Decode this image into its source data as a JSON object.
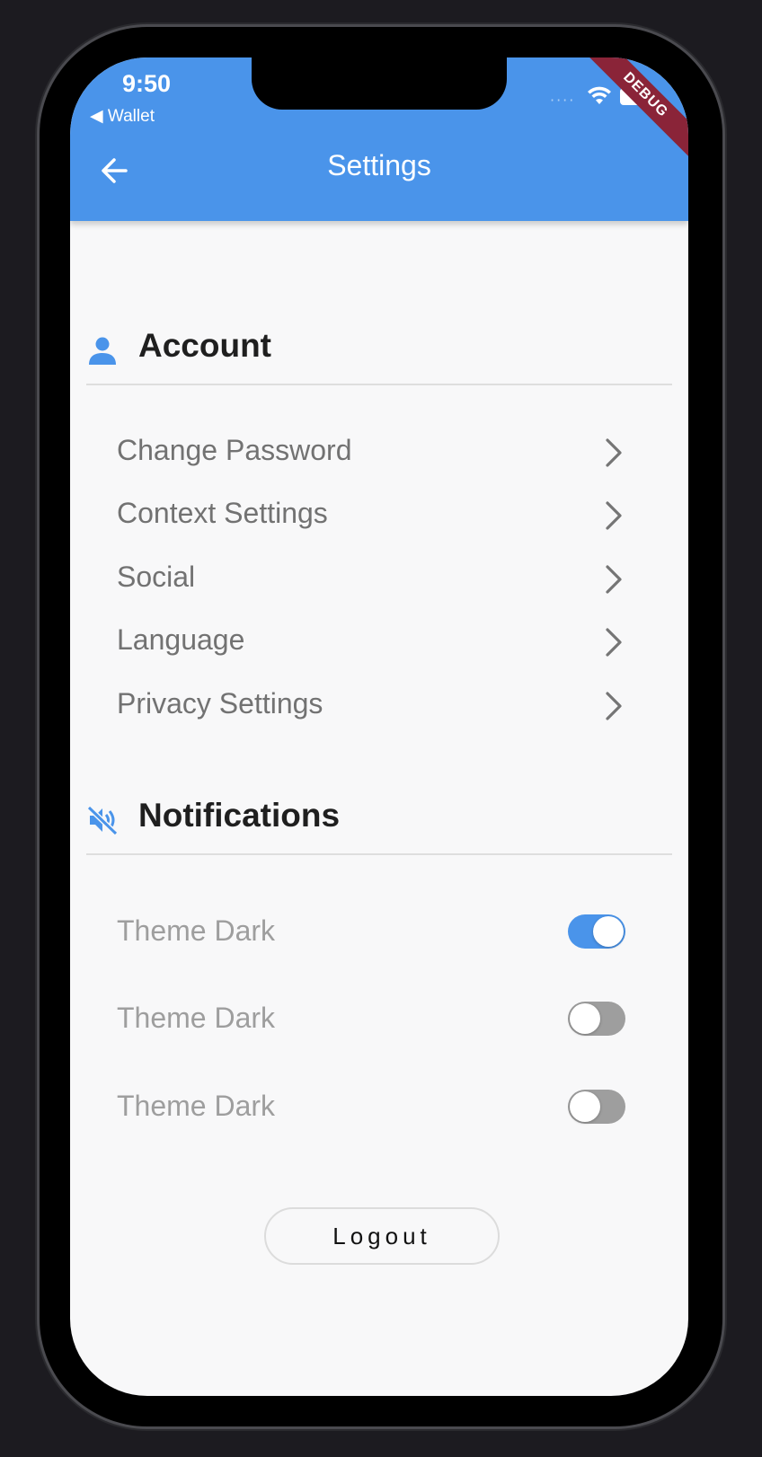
{
  "status_bar": {
    "time": "9:50",
    "back_app": "◀ Wallet",
    "signal": "····",
    "debug_banner": "DEBUG"
  },
  "app_bar": {
    "title": "Settings",
    "back_icon": "arrow-left-icon",
    "color": "#4a94ea"
  },
  "account": {
    "title": "Account",
    "icon": "person-icon",
    "items": [
      {
        "label": "Change Password"
      },
      {
        "label": "Context Settings"
      },
      {
        "label": "Social"
      },
      {
        "label": "Language"
      },
      {
        "label": "Privacy Settings"
      }
    ]
  },
  "notifications": {
    "title": "Notifications",
    "icon": "volume-off-icon",
    "toggles": [
      {
        "label": "Theme Dark",
        "on": true
      },
      {
        "label": "Theme Dark",
        "on": false
      },
      {
        "label": "Theme Dark",
        "on": false
      }
    ]
  },
  "logout_label": "Logout",
  "colors": {
    "accent": "#4a94ea",
    "background": "#f8f8f9",
    "debug": "#8a2438"
  }
}
